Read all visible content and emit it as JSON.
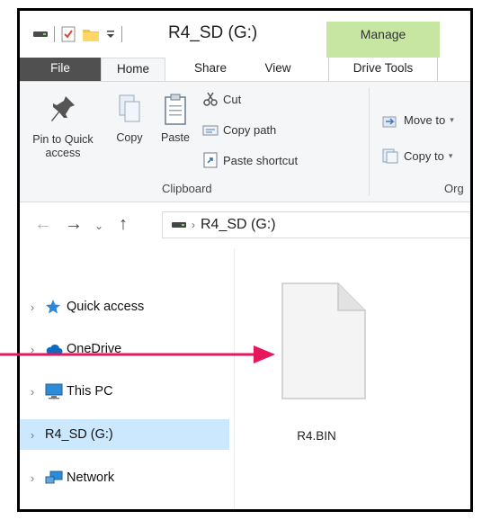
{
  "window": {
    "title": "R4_SD (G:)",
    "context_tab_label": "Manage"
  },
  "tabs": [
    {
      "label": "File"
    },
    {
      "label": "Home"
    },
    {
      "label": "Share"
    },
    {
      "label": "View"
    },
    {
      "label": "Drive Tools"
    }
  ],
  "ribbon": {
    "pin_to_quick_access": "Pin to Quick access",
    "copy": "Copy",
    "paste": "Paste",
    "cut": "Cut",
    "copy_path": "Copy path",
    "paste_shortcut": "Paste shortcut",
    "clipboard_group": "Clipboard",
    "move_to": "Move to",
    "copy_to": "Copy to",
    "organize_group_partial": "Org"
  },
  "address_bar": {
    "path_item": "R4_SD (G:)"
  },
  "sidebar": {
    "items": [
      {
        "label": "Quick access",
        "icon": "star-icon"
      },
      {
        "label": "OneDrive",
        "icon": "cloud-icon"
      },
      {
        "label": "This PC",
        "icon": "computer-icon"
      },
      {
        "label": "R4_SD (G:)",
        "icon": "drive-icon",
        "selected": true
      },
      {
        "label": "Network",
        "icon": "network-icon"
      }
    ]
  },
  "content": {
    "files": [
      {
        "name": "R4.BIN",
        "icon": "blank-file-icon"
      }
    ]
  },
  "colors": {
    "selected_bg": "#cce8ff",
    "manage_tab": "#c7e6a1",
    "arrow": "#e6175c",
    "file_tab": "#505050"
  }
}
